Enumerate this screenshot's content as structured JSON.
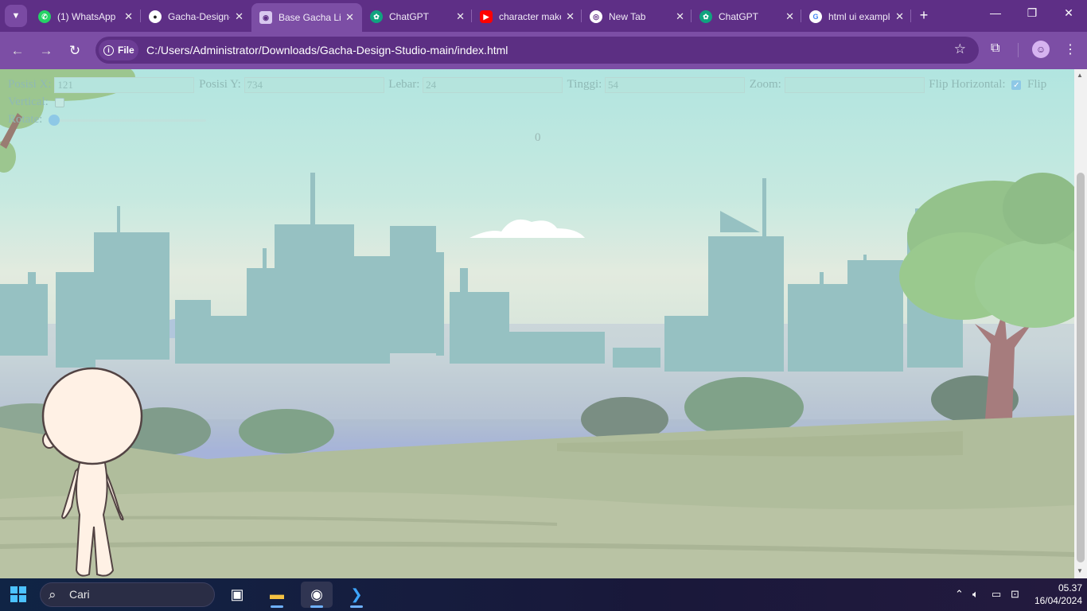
{
  "browser": {
    "tabs": [
      {
        "title": "(1) WhatsApp",
        "icon": "whatsapp-icon",
        "color": "#25d366"
      },
      {
        "title": "Gacha-Design-Studio",
        "icon": "github-icon",
        "color": "#ffffff"
      },
      {
        "title": "Base Gacha Life",
        "icon": "gacha-icon",
        "color": "#d8c8ef",
        "active": true
      },
      {
        "title": "ChatGPT",
        "icon": "chatgpt-icon",
        "color": "#10a37f"
      },
      {
        "title": "character maker",
        "icon": "youtube-icon",
        "color": "#ff0000"
      },
      {
        "title": "New Tab",
        "icon": "chrome-icon",
        "color": "#ffffff"
      },
      {
        "title": "ChatGPT",
        "icon": "chatgpt-icon",
        "color": "#10a37f"
      },
      {
        "title": "html ui examples",
        "icon": "google-icon",
        "color": "#ffffff"
      }
    ],
    "address": {
      "chip_label": "File",
      "url": "C:/Users/Administrator/Downloads/Gacha-Design-Studio-main/index.html"
    }
  },
  "controls": {
    "pos_x_label": "Posisi X:",
    "pos_x_value": "121",
    "pos_y_label": "Posisi Y:",
    "pos_y_value": "734",
    "width_label": "Lebar:",
    "width_value": "24",
    "height_label": "Tinggi:",
    "height_value": "54",
    "zoom_label": "Zoom:",
    "zoom_value": "",
    "flip_h_label": "Flip Horizontal:",
    "flip_h_checked": true,
    "flip_v_label": "Flip Vertical:",
    "flip_v_checked": false,
    "rotate_label": "Rotate:",
    "rotate_value": 0
  },
  "counter": "0",
  "taskbar": {
    "search_placeholder": "Cari",
    "apps": [
      "task-view-icon",
      "file-explorer-icon",
      "chrome-icon",
      "vscode-icon"
    ],
    "time": "05.37",
    "date": "16/04/2024"
  }
}
